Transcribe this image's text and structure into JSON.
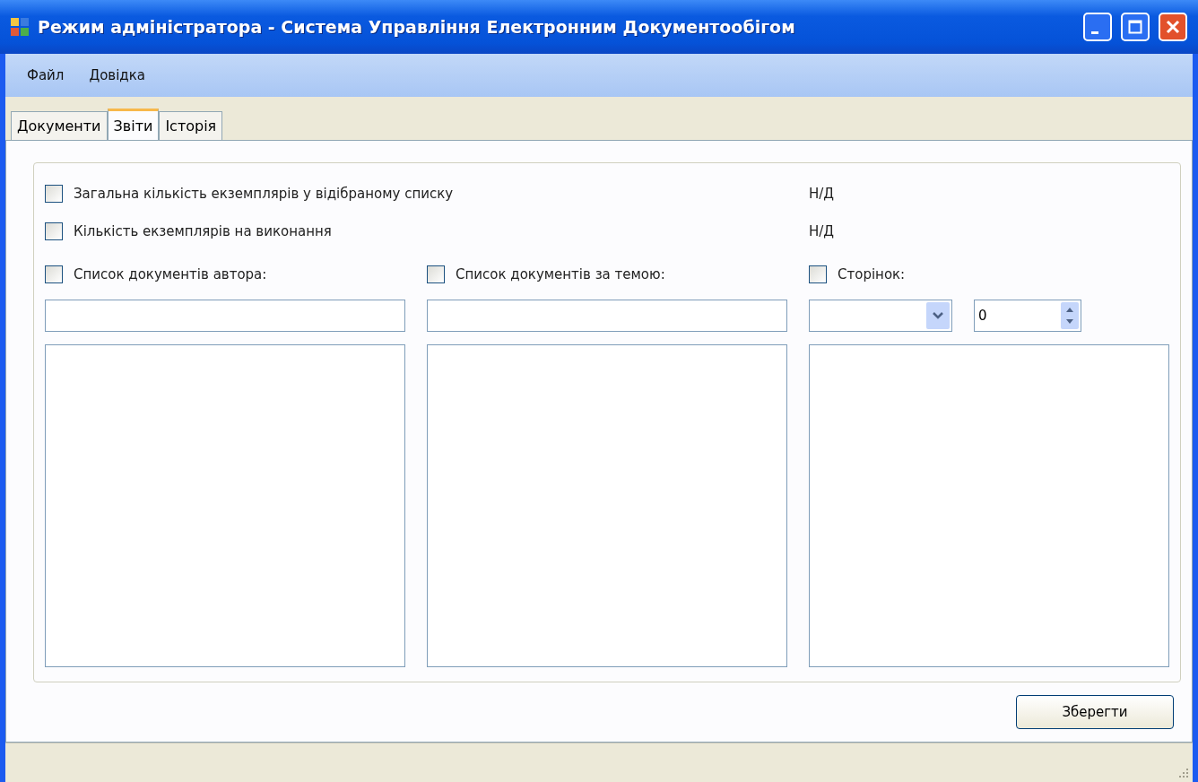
{
  "window": {
    "title": "Режим  адміністратора - Система Управління Електронним Документообігом"
  },
  "menu": [
    "Файл",
    "Довідка"
  ],
  "tabs": [
    {
      "label": "Документи",
      "selected": false
    },
    {
      "label": "Звіти",
      "selected": true
    },
    {
      "label": "Історія",
      "selected": false
    }
  ],
  "stats": [
    {
      "label": "Загальна кількість екземплярів у відібраному списку",
      "checked": false,
      "value": "Н/Д"
    },
    {
      "label": "Кількість екземплярів на виконання",
      "checked": false,
      "value": "Н/Д"
    }
  ],
  "columns": [
    {
      "kind": "text",
      "label": "Список документів автора:",
      "checked": false
    },
    {
      "kind": "text",
      "label": "Список документів за темою:",
      "checked": false
    },
    {
      "kind": "pages",
      "label": "Сторінок:",
      "checked": false,
      "spin_value": "0"
    }
  ],
  "buttons": [
    "Зберегти"
  ]
}
